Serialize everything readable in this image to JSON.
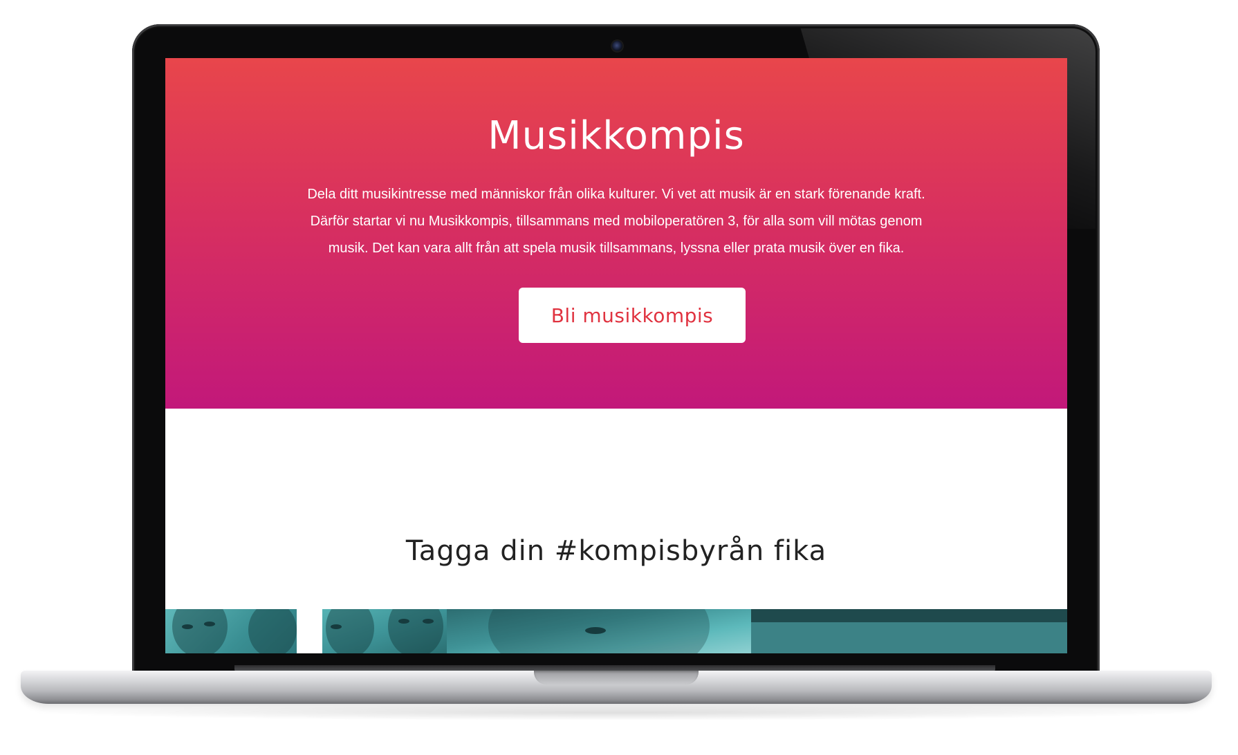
{
  "hero": {
    "title": "Musikkompis",
    "description": "Dela ditt musikintresse med människor från olika kulturer. Vi vet att musik är en stark förenande kraft. Därför startar vi nu Musikkompis, tillsammans med mobiloperatören 3, för alla som vill mötas genom musik. Det kan vara allt från att spela musik tillsammans, lyssna eller prata musik över en fika.",
    "cta_label": "Bli musikkompis",
    "gradient_top": "#e8464b",
    "gradient_bottom": "#c2187a",
    "cta_text_color": "#e03340"
  },
  "section": {
    "title": "Tagga din #kompisbyrån fika"
  },
  "gallery": {
    "tint": "#3f9296",
    "photos": [
      "photo-1",
      "photo-2",
      "photo-3",
      "photo-4"
    ]
  }
}
